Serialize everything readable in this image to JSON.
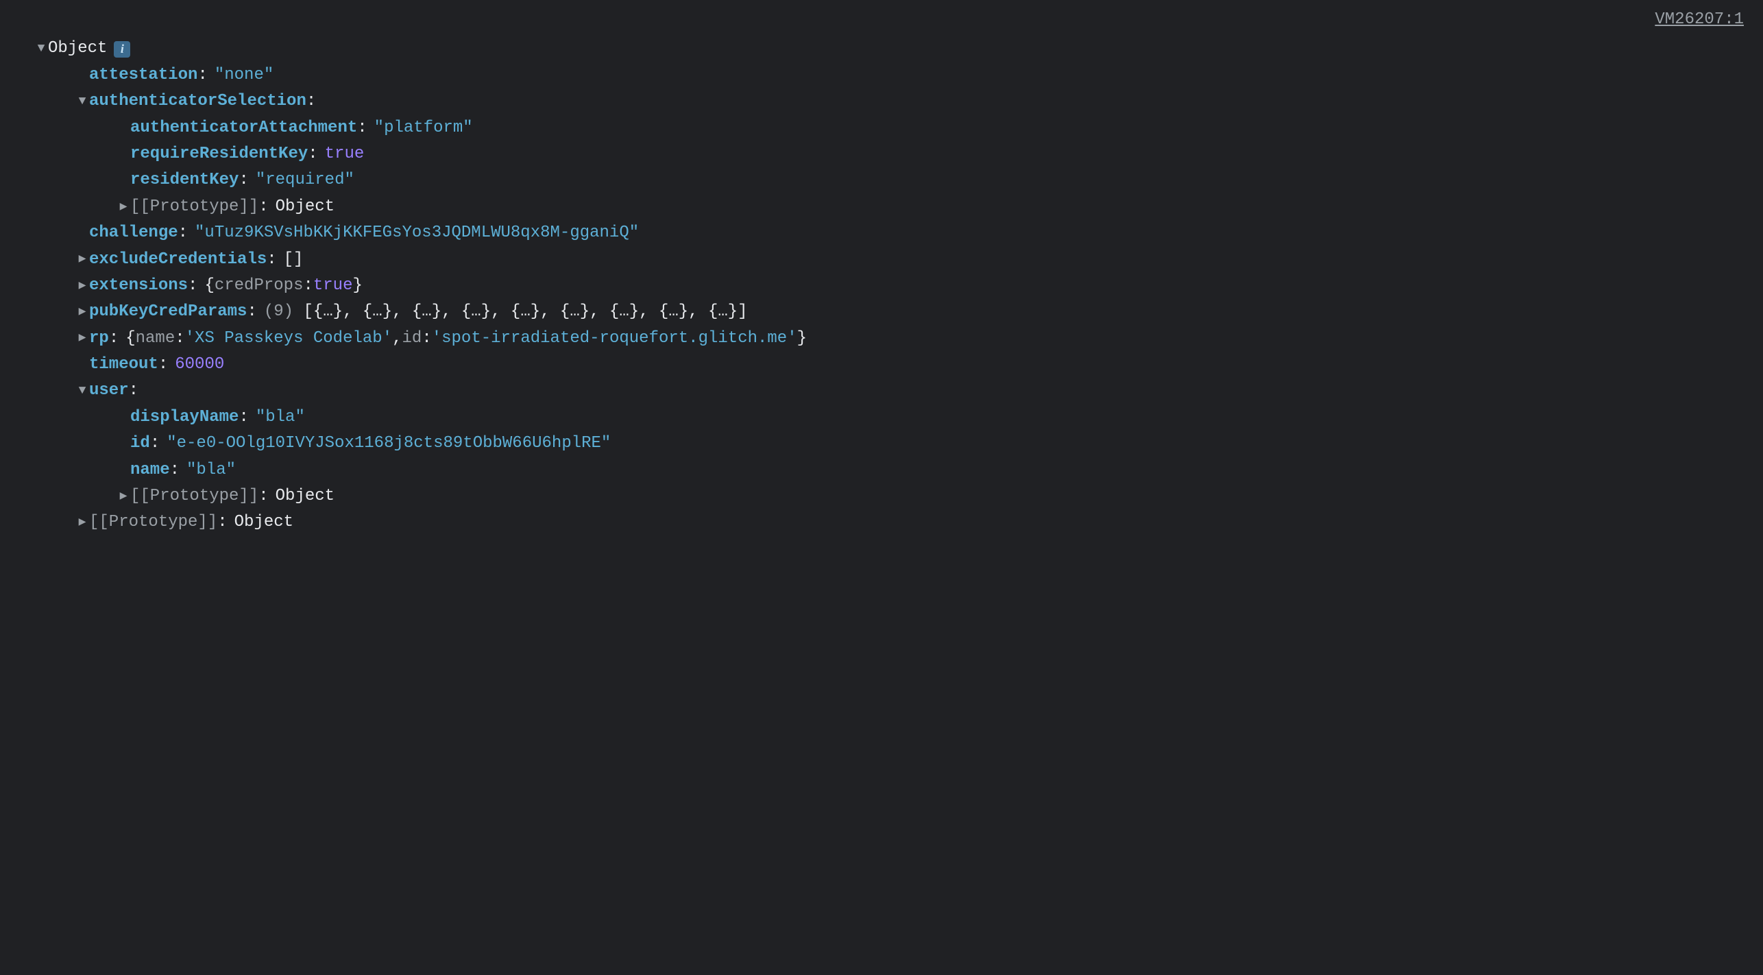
{
  "source": "VM26207:1",
  "root_label": "Object",
  "info_badge": "i",
  "entries": {
    "attestation": {
      "key": "attestation",
      "value": "\"none\""
    },
    "authenticatorSelection": {
      "key": "authenticatorSelection",
      "authenticatorAttachment": {
        "key": "authenticatorAttachment",
        "value": "\"platform\""
      },
      "requireResidentKey": {
        "key": "requireResidentKey",
        "value": "true"
      },
      "residentKey": {
        "key": "residentKey",
        "value": "\"required\""
      },
      "prototype": {
        "key": "[[Prototype]]",
        "value": "Object"
      }
    },
    "challenge": {
      "key": "challenge",
      "value": "\"uTuz9KSVsHbKKjKKFEGsYos3JQDMLWU8qx8M-gganiQ\""
    },
    "excludeCredentials": {
      "key": "excludeCredentials",
      "value": "[]"
    },
    "extensions": {
      "key": "extensions",
      "open_brace": "{",
      "credProps_key": "credProps",
      "credProps_val": "true",
      "close_brace": "}"
    },
    "pubKeyCredParams": {
      "key": "pubKeyCredParams",
      "count": "(9)",
      "preview": "[{…}, {…}, {…}, {…}, {…}, {…}, {…}, {…}, {…}]"
    },
    "rp": {
      "key": "rp",
      "open_brace": "{",
      "name_key": "name",
      "name_val": "'XS Passkeys Codelab'",
      "sep": ", ",
      "id_key": "id",
      "id_val": "'spot-irradiated-roquefort.glitch.me'",
      "close_brace": "}"
    },
    "timeout": {
      "key": "timeout",
      "value": "60000"
    },
    "user": {
      "key": "user",
      "displayName": {
        "key": "displayName",
        "value": "\"bla\""
      },
      "id": {
        "key": "id",
        "value": "\"e-e0-OOlg10IVYJSox1168j8cts89tObbW66U6hplRE\""
      },
      "name": {
        "key": "name",
        "value": "\"bla\""
      },
      "prototype": {
        "key": "[[Prototype]]",
        "value": "Object"
      }
    },
    "prototype": {
      "key": "[[Prototype]]",
      "value": "Object"
    }
  }
}
